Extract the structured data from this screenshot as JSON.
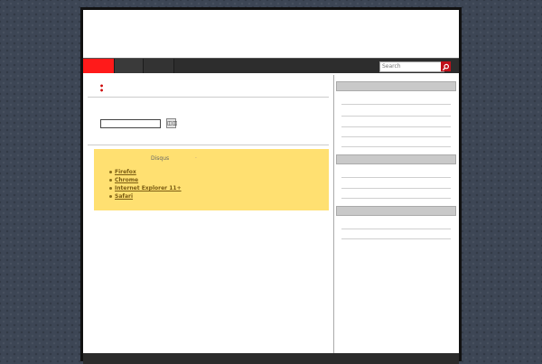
{
  "search": {
    "placeholder": "Search",
    "icon": "search-icon"
  },
  "form": {
    "button_label": "◫◫"
  },
  "notice": {
    "title": "Disqus",
    "separator": "·",
    "browsers": [
      "Firefox",
      "Chrome",
      "Internet Explorer 11+",
      "Safari"
    ]
  },
  "post": {
    "meta_dots": "•\n•"
  },
  "colors": {
    "nav_active": "#ff1a1a",
    "nav_bar": "#2d2d2d",
    "notice_bg": "#ffe071",
    "search_button": "#c0101a",
    "link": "#7a5c12"
  }
}
